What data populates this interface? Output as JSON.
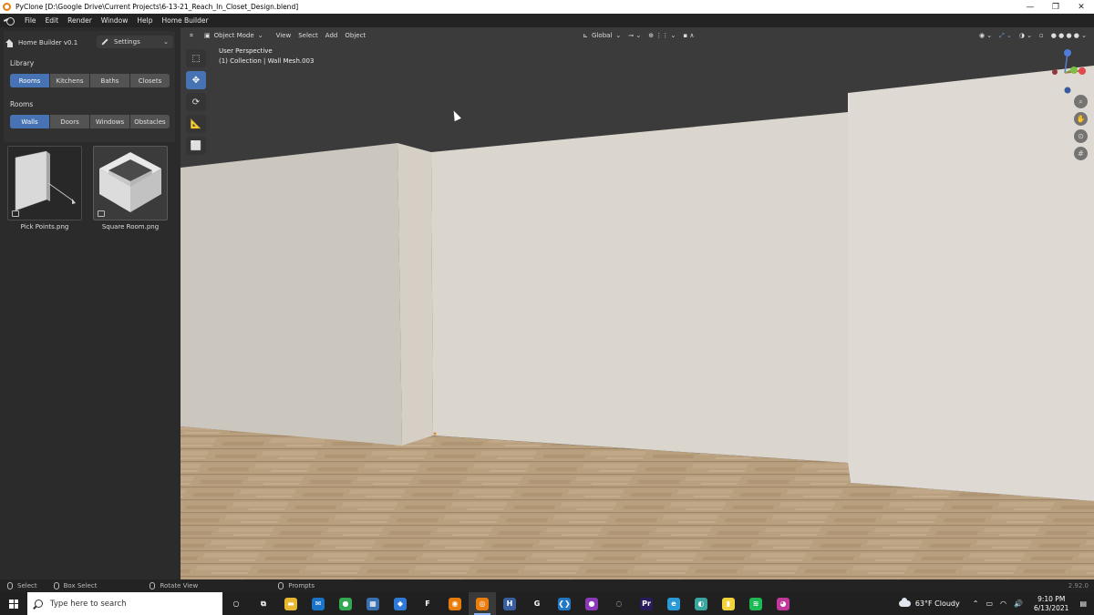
{
  "window": {
    "title": "PyClone [D:\\Google Drive\\Current Projects\\6-13-21_Reach_In_Closet_Design.blend]",
    "minimize_glyph": "—",
    "maximize_glyph": "❐",
    "close_glyph": "✕"
  },
  "menubar": {
    "items": [
      "File",
      "Edit",
      "Render",
      "Window",
      "Help",
      "Home Builder"
    ]
  },
  "left_panel": {
    "title": "Home Builder v0.1",
    "settings_label": "Settings",
    "library_label": "Library",
    "library_tabs": [
      {
        "label": "Rooms",
        "active": true
      },
      {
        "label": "Kitchens",
        "active": false
      },
      {
        "label": "Baths",
        "active": false
      },
      {
        "label": "Closets",
        "active": false
      }
    ],
    "rooms_label": "Rooms",
    "room_tabs": [
      {
        "label": "Walls",
        "active": true
      },
      {
        "label": "Doors",
        "active": false
      },
      {
        "label": "Windows",
        "active": false
      },
      {
        "label": "Obstacles",
        "active": false
      }
    ],
    "assets": [
      {
        "label": "Pick Points.png",
        "selected": false
      },
      {
        "label": "Square Room.png",
        "selected": true
      }
    ]
  },
  "viewport": {
    "header": {
      "editor_type_glyph": "⌗",
      "mode": "Object Mode",
      "menus": [
        "View",
        "Select",
        "Add",
        "Object"
      ],
      "orientation": "Global"
    },
    "info_line1": "User Perspective",
    "info_line2": "(1) Collection | Wall Mesh.003",
    "tools": [
      {
        "name": "select-box-tool",
        "glyph": "⬚",
        "active": false
      },
      {
        "name": "move-tool",
        "glyph": "✥",
        "active": true
      },
      {
        "name": "rotate-tool",
        "glyph": "⟳",
        "active": false
      },
      {
        "name": "measure-tool",
        "glyph": "📐",
        "active": false
      },
      {
        "name": "add-cube-tool",
        "glyph": "⬜",
        "active": false
      }
    ],
    "nav": [
      {
        "name": "zoom-icon",
        "glyph": "⌕"
      },
      {
        "name": "hand-pan-icon",
        "glyph": "✋"
      },
      {
        "name": "camera-icon",
        "glyph": "⊙"
      },
      {
        "name": "grid-icon",
        "glyph": "#"
      }
    ]
  },
  "statusbar": {
    "items": [
      "Select",
      "Box Select",
      "Rotate View",
      "Prompts"
    ],
    "version": "2.92.0"
  },
  "taskbar": {
    "search_placeholder": "Type here to search",
    "apps": [
      {
        "name": "cortana-icon",
        "glyph": "○",
        "color": "#202020",
        "active": false
      },
      {
        "name": "task-view-icon",
        "glyph": "⧉",
        "color": "#202020",
        "active": false
      },
      {
        "name": "file-explorer-icon",
        "glyph": "▬",
        "color": "#e8b730",
        "active": false
      },
      {
        "name": "mail-icon",
        "glyph": "✉",
        "color": "#1a73c8",
        "active": false
      },
      {
        "name": "chrome-icon",
        "glyph": "●",
        "color": "#34a853",
        "active": false
      },
      {
        "name": "calculator-icon",
        "glyph": "▦",
        "color": "#3a6fb0",
        "active": false
      },
      {
        "name": "app-blue-icon",
        "glyph": "◆",
        "color": "#2f7ad6",
        "active": false
      },
      {
        "name": "app-f-icon",
        "glyph": "F",
        "color": "#202020",
        "active": false
      },
      {
        "name": "blender-icon",
        "glyph": "◉",
        "color": "#e87d0d",
        "active": false
      },
      {
        "name": "pyclone-icon",
        "glyph": "◎",
        "color": "#e87d0d",
        "active": true
      },
      {
        "name": "app-h-icon",
        "glyph": "H",
        "color": "#3a5f9f",
        "active": false
      },
      {
        "name": "app-g-icon",
        "glyph": "G",
        "color": "#202020",
        "active": false
      },
      {
        "name": "vscode-icon",
        "glyph": "❮❯",
        "color": "#2178c4",
        "active": false
      },
      {
        "name": "github-icon",
        "glyph": "●",
        "color": "#8a3ab9",
        "active": false
      },
      {
        "name": "app-circle-icon",
        "glyph": "◌",
        "color": "#202020",
        "active": false
      },
      {
        "name": "premiere-icon",
        "glyph": "Pr",
        "color": "#2a1a5e",
        "active": false
      },
      {
        "name": "edge-icon",
        "glyph": "e",
        "color": "#2a9ad6",
        "active": false
      },
      {
        "name": "app-paint-icon",
        "glyph": "◐",
        "color": "#3ba5a0",
        "active": false
      },
      {
        "name": "sticky-notes-icon",
        "glyph": "▮",
        "color": "#f2d33a",
        "active": false
      },
      {
        "name": "spotify-icon",
        "glyph": "≋",
        "color": "#1db954",
        "active": false
      },
      {
        "name": "app-pink-icon",
        "glyph": "◕",
        "color": "#c0399a",
        "active": false
      }
    ],
    "weather": "63°F  Cloudy",
    "tray_glyphs": [
      "⌃",
      "▭",
      "◠",
      "🔊"
    ],
    "time": "9:10 PM",
    "date": "6/13/2021",
    "notification_glyph": "▤"
  },
  "colors": {
    "accent": "#4772b3",
    "panel_bg": "#2b2b2b",
    "viewport_sky": "#3a3a3a",
    "wall": "#d8d4cc",
    "floor": "#b49b7a"
  }
}
